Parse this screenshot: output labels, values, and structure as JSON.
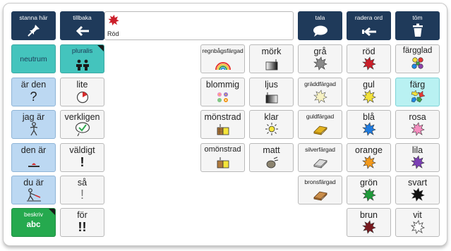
{
  "top_bar": {
    "stop": {
      "label": "stanna här",
      "icon": "pin-icon"
    },
    "back": {
      "label": "tillbaka",
      "icon": "arrow-left-icon"
    },
    "speak": {
      "label": "tala",
      "icon": "speech-bubble-icon"
    },
    "delete_word": {
      "label": "radera ord",
      "icon": "backspace-icon"
    },
    "clear": {
      "label": "töm",
      "icon": "trash-icon"
    }
  },
  "message": {
    "text": "Röd",
    "icon": "red-splash-icon",
    "icon_color": "#cc1f2a"
  },
  "left_column": [
    {
      "label": "neutrum",
      "style": "teal"
    },
    {
      "label": "är den",
      "symbol": "?",
      "style": "blue"
    },
    {
      "label": "jag är",
      "icon": "person-icon",
      "style": "blue"
    },
    {
      "label": "den är",
      "icon": "object-on-surface-icon",
      "style": "blue"
    },
    {
      "label": "du är",
      "icon": "person-pointing-icon",
      "style": "blue"
    },
    {
      "label": "beskriv",
      "symbol": "abc",
      "style": "green"
    }
  ],
  "second_column": [
    {
      "label": "pluralis",
      "icon": "two-people-icon",
      "style": "teal"
    },
    {
      "label": "lite",
      "icon": "small-pie-icon"
    },
    {
      "label": "verkligen",
      "icon": "checkmark-bubble-icon"
    },
    {
      "label": "väldigt",
      "symbol": "!"
    },
    {
      "label": "så",
      "symbol": "!"
    },
    {
      "label": "för",
      "symbol": "!!"
    }
  ],
  "grid": {
    "row1": [
      {
        "label": "regnbågsfärgad",
        "icon": "rainbow-icon"
      },
      {
        "label": "mörk",
        "icon": "dark-gradient-icon"
      },
      {
        "label": "grå",
        "icon": "gray-splash-icon",
        "color": "#8a8a8a"
      },
      {
        "label": "röd",
        "icon": "red-splash-icon",
        "color": "#cc1f2a"
      },
      {
        "label": "färgglad",
        "icon": "colorful-dots-icon"
      }
    ],
    "row2": [
      {
        "label": "blommig",
        "icon": "flowers-icon"
      },
      {
        "label": "ljus",
        "icon": "light-gradient-icon"
      },
      {
        "label": "gräddfärgad",
        "icon": "cream-splash-icon",
        "color": "#f6f1c2"
      },
      {
        "label": "gul",
        "icon": "yellow-splash-icon",
        "color": "#f3e23a"
      },
      {
        "label": "färg",
        "icon": "color-splashes-icon"
      }
    ],
    "row3": [
      {
        "label": "mönstrad",
        "icon": "patterned-blocks-icon"
      },
      {
        "label": "klar",
        "icon": "bright-light-icon"
      },
      {
        "label": "guldfärgad",
        "icon": "gold-bar-icon",
        "color": "#e2b21f"
      },
      {
        "label": "blå",
        "icon": "blue-splash-icon",
        "color": "#1e7be0"
      },
      {
        "label": "rosa",
        "icon": "pink-splash-icon",
        "color": "#f48fc0"
      }
    ],
    "row4": [
      {
        "label": "omönstrad",
        "icon": "plain-blocks-icon"
      },
      {
        "label": "matt",
        "icon": "matte-ball-icon"
      },
      {
        "label": "silverfärgad",
        "icon": "silver-bar-icon",
        "color": "#d9d9d9"
      },
      {
        "label": "orange",
        "icon": "orange-splash-icon",
        "color": "#f39a1d"
      },
      {
        "label": "lila",
        "icon": "purple-splash-icon",
        "color": "#7b3fb5"
      }
    ],
    "row5": [
      {
        "label": "bronsfärgad",
        "icon": "bronze-bar-icon",
        "color": "#c98d4a"
      },
      {
        "label": "grön",
        "icon": "green-splash-icon",
        "color": "#1f9b3a"
      },
      {
        "label": "svart",
        "icon": "black-splash-icon",
        "color": "#111111"
      }
    ],
    "row6": [
      {
        "label": "brun",
        "icon": "brown-splash-icon",
        "color": "#7a1a1f"
      },
      {
        "label": "vit",
        "icon": "white-splash-icon",
        "color": "#ffffff"
      }
    ]
  }
}
